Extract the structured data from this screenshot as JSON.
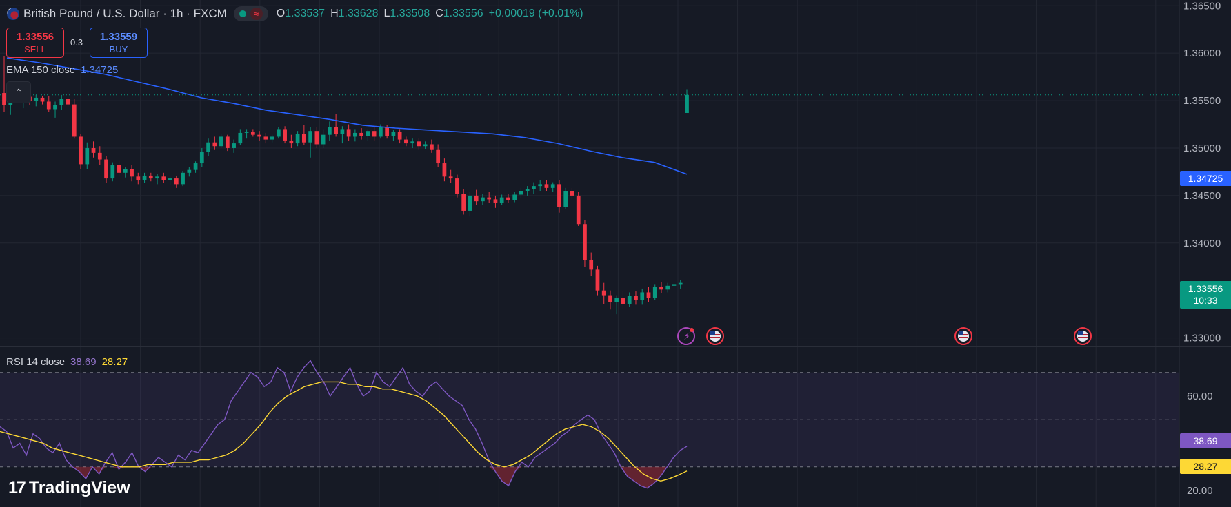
{
  "header": {
    "title": "British Pound / U.S. Dollar · 1h · FXCM",
    "ohlc": [
      {
        "k": "O",
        "v": "1.33537"
      },
      {
        "k": "H",
        "v": "1.33628"
      },
      {
        "k": "L",
        "v": "1.33508"
      },
      {
        "k": "C",
        "v": "1.33556"
      }
    ],
    "change": "+0.00019 (+0.01%)",
    "wave_glyph": "≈"
  },
  "trade": {
    "sell_price": "1.33556",
    "sell_label": "SELL",
    "buy_price": "1.33559",
    "buy_label": "BUY",
    "spread": "0.3"
  },
  "ema": {
    "label": "EMA 150 close",
    "value": "1.34725"
  },
  "rsi": {
    "label": "RSI 14 close",
    "value": "38.69",
    "ma_value": "28.27"
  },
  "price_tags": {
    "ema": "1.34725",
    "last": "1.33556",
    "countdown": "10:33",
    "rsi": "38.69",
    "rsi_ma": "28.27"
  },
  "colors": {
    "up": "#089981",
    "down": "#f23645",
    "ema": "#2962ff",
    "rsi": "#7e57c2",
    "rsi_ma": "#fdd835",
    "bg": "#161a25",
    "grid": "#232733"
  },
  "brand": "TradingView",
  "chart_data": [
    {
      "type": "candlestick",
      "title": "British Pound / U.S. Dollar · 1h · FXCM",
      "y_ticks": [
        "1.36500",
        "1.36000",
        "1.35500",
        "1.35000",
        "1.34500",
        "1.34000",
        "1.33000"
      ],
      "ylim": [
        1.3291,
        1.3656
      ],
      "candles": [
        [
          1.3558,
          1.3597,
          1.3538,
          1.3545
        ],
        [
          1.3545,
          1.356,
          1.3535,
          1.3552
        ],
        [
          1.3552,
          1.3558,
          1.354,
          1.3548
        ],
        [
          1.3548,
          1.3556,
          1.3542,
          1.3554
        ],
        [
          1.3554,
          1.3557,
          1.3545,
          1.355
        ],
        [
          1.355,
          1.3556,
          1.3544,
          1.3553
        ],
        [
          1.3553,
          1.3555,
          1.3546,
          1.3549
        ],
        [
          1.3549,
          1.3555,
          1.3538,
          1.3541
        ],
        [
          1.3541,
          1.3549,
          1.3532,
          1.3545
        ],
        [
          1.3545,
          1.3556,
          1.354,
          1.3552
        ],
        [
          1.3552,
          1.356,
          1.3543,
          1.3546
        ],
        [
          1.3546,
          1.3552,
          1.351,
          1.3512
        ],
        [
          1.3512,
          1.3515,
          1.3478,
          1.3483
        ],
        [
          1.3483,
          1.3506,
          1.3478,
          1.35
        ],
        [
          1.35,
          1.3507,
          1.349,
          1.3495
        ],
        [
          1.3495,
          1.3502,
          1.3482,
          1.3488
        ],
        [
          1.3488,
          1.3492,
          1.3463,
          1.3468
        ],
        [
          1.3468,
          1.3485,
          1.3465,
          1.3482
        ],
        [
          1.3482,
          1.3487,
          1.347,
          1.3474
        ],
        [
          1.3474,
          1.348,
          1.3469,
          1.3478
        ],
        [
          1.3478,
          1.3482,
          1.3465,
          1.347
        ],
        [
          1.347,
          1.3474,
          1.3462,
          1.3466
        ],
        [
          1.3466,
          1.3474,
          1.3463,
          1.3471
        ],
        [
          1.3471,
          1.3474,
          1.3465,
          1.3468
        ],
        [
          1.3468,
          1.3473,
          1.3462,
          1.347
        ],
        [
          1.347,
          1.3474,
          1.3463,
          1.3466
        ],
        [
          1.3466,
          1.347,
          1.3461,
          1.3468
        ],
        [
          1.3468,
          1.3471,
          1.3458,
          1.3462
        ],
        [
          1.3462,
          1.3476,
          1.346,
          1.3474
        ],
        [
          1.3474,
          1.348,
          1.347,
          1.3477
        ],
        [
          1.3477,
          1.3486,
          1.3474,
          1.3484
        ],
        [
          1.3484,
          1.35,
          1.348,
          1.3496
        ],
        [
          1.3496,
          1.351,
          1.3492,
          1.3506
        ],
        [
          1.3506,
          1.3512,
          1.3498,
          1.3502
        ],
        [
          1.3502,
          1.3515,
          1.35,
          1.3512
        ],
        [
          1.3512,
          1.3514,
          1.3497,
          1.35
        ],
        [
          1.35,
          1.3509,
          1.3495,
          1.3505
        ],
        [
          1.3505,
          1.352,
          1.3503,
          1.3516
        ],
        [
          1.3516,
          1.352,
          1.351,
          1.3517
        ],
        [
          1.3517,
          1.352,
          1.3512,
          1.3514
        ],
        [
          1.3514,
          1.3518,
          1.3508,
          1.3512
        ],
        [
          1.3512,
          1.3516,
          1.3505,
          1.3509
        ],
        [
          1.3509,
          1.3514,
          1.3506,
          1.3512
        ],
        [
          1.3512,
          1.3522,
          1.351,
          1.352
        ],
        [
          1.352,
          1.3523,
          1.3505,
          1.3508
        ],
        [
          1.3508,
          1.3514,
          1.35,
          1.3505
        ],
        [
          1.3505,
          1.3518,
          1.3502,
          1.3515
        ],
        [
          1.3515,
          1.3524,
          1.3503,
          1.3506
        ],
        [
          1.3506,
          1.3522,
          1.349,
          1.3518
        ],
        [
          1.3518,
          1.3522,
          1.35,
          1.3504
        ],
        [
          1.3504,
          1.352,
          1.35,
          1.3514
        ],
        [
          1.3514,
          1.3528,
          1.3508,
          1.3522
        ],
        [
          1.3522,
          1.3536,
          1.3512,
          1.3515
        ],
        [
          1.3515,
          1.3523,
          1.3505,
          1.352
        ],
        [
          1.352,
          1.3525,
          1.3508,
          1.3512
        ],
        [
          1.3512,
          1.352,
          1.3507,
          1.3516
        ],
        [
          1.3516,
          1.3521,
          1.3509,
          1.3513
        ],
        [
          1.3513,
          1.352,
          1.3508,
          1.3518
        ],
        [
          1.3518,
          1.3522,
          1.3508,
          1.3512
        ],
        [
          1.3512,
          1.3525,
          1.351,
          1.3522
        ],
        [
          1.3522,
          1.3524,
          1.351,
          1.3513
        ],
        [
          1.3513,
          1.3519,
          1.3508,
          1.3517
        ],
        [
          1.3517,
          1.352,
          1.3505,
          1.3509
        ],
        [
          1.3509,
          1.3512,
          1.3502,
          1.3505
        ],
        [
          1.3505,
          1.351,
          1.35,
          1.3507
        ],
        [
          1.3507,
          1.351,
          1.3498,
          1.3502
        ],
        [
          1.3502,
          1.3507,
          1.3499,
          1.3504
        ],
        [
          1.3504,
          1.3509,
          1.3495,
          1.3498
        ],
        [
          1.3498,
          1.3504,
          1.348,
          1.3484
        ],
        [
          1.3484,
          1.3489,
          1.3465,
          1.347
        ],
        [
          1.347,
          1.3477,
          1.3463,
          1.3468
        ],
        [
          1.3468,
          1.3472,
          1.3448,
          1.3452
        ],
        [
          1.3452,
          1.3457,
          1.343,
          1.3434
        ],
        [
          1.3434,
          1.3454,
          1.3428,
          1.345
        ],
        [
          1.345,
          1.3456,
          1.344,
          1.3444
        ],
        [
          1.3444,
          1.3452,
          1.344,
          1.3448
        ],
        [
          1.3448,
          1.3454,
          1.3442,
          1.3446
        ],
        [
          1.3446,
          1.345,
          1.3437,
          1.3442
        ],
        [
          1.3442,
          1.3451,
          1.344,
          1.3448
        ],
        [
          1.3448,
          1.3452,
          1.3442,
          1.3445
        ],
        [
          1.3445,
          1.3454,
          1.3443,
          1.3451
        ],
        [
          1.3451,
          1.3458,
          1.3447,
          1.3455
        ],
        [
          1.3455,
          1.346,
          1.345,
          1.3457
        ],
        [
          1.3457,
          1.3464,
          1.3452,
          1.346
        ],
        [
          1.346,
          1.3466,
          1.3455,
          1.3462
        ],
        [
          1.3462,
          1.3466,
          1.3455,
          1.3458
        ],
        [
          1.3458,
          1.3464,
          1.3454,
          1.3462
        ],
        [
          1.3462,
          1.3466,
          1.3432,
          1.3438
        ],
        [
          1.3438,
          1.3458,
          1.3436,
          1.3455
        ],
        [
          1.3455,
          1.3458,
          1.3446,
          1.345
        ],
        [
          1.345,
          1.3454,
          1.3418,
          1.342
        ],
        [
          1.342,
          1.3424,
          1.3375,
          1.3382
        ],
        [
          1.3382,
          1.339,
          1.3365,
          1.3372
        ],
        [
          1.3372,
          1.3376,
          1.3345,
          1.335
        ],
        [
          1.335,
          1.3358,
          1.3336,
          1.3345
        ],
        [
          1.3345,
          1.335,
          1.333,
          1.3338
        ],
        [
          1.3338,
          1.3345,
          1.3325,
          1.3342
        ],
        [
          1.3342,
          1.335,
          1.333,
          1.3336
        ],
        [
          1.3336,
          1.3348,
          1.3333,
          1.3344
        ],
        [
          1.3344,
          1.3349,
          1.3335,
          1.334
        ],
        [
          1.334,
          1.3352,
          1.3335,
          1.3348
        ],
        [
          1.3348,
          1.3354,
          1.3338,
          1.3342
        ],
        [
          1.3342,
          1.3356,
          1.334,
          1.3354
        ],
        [
          1.3354,
          1.3359,
          1.3347,
          1.3351
        ],
        [
          1.3351,
          1.3358,
          1.3348,
          1.3355
        ],
        [
          1.3355,
          1.3359,
          1.3352,
          1.3356
        ],
        [
          1.3356,
          1.3361,
          1.3352,
          1.3358
        ],
        [
          1.3537,
          1.3562,
          1.355,
          1.3556
        ]
      ],
      "ema150": [
        1.3595,
        1.359,
        1.3584,
        1.3578,
        1.357,
        1.3562,
        1.3553,
        1.3547,
        1.354,
        1.3535,
        1.353,
        1.3524,
        1.3521,
        1.3519,
        1.3517,
        1.3515,
        1.3511,
        1.3505,
        1.3497,
        1.349,
        1.3485,
        1.34725
      ],
      "series": [
        {
          "name": "EMA 150 close"
        }
      ]
    },
    {
      "type": "line",
      "y_ticks": [
        "60.00",
        "20.00"
      ],
      "ylim": [
        13,
        81
      ],
      "bands": [
        70,
        50,
        30
      ],
      "rsi": [
        47,
        45,
        38,
        40,
        35,
        44,
        42,
        38,
        36,
        40,
        33,
        30,
        28,
        25,
        30,
        27,
        32,
        36,
        29,
        32,
        36,
        30,
        28,
        31,
        34,
        32,
        30,
        35,
        33,
        37,
        36,
        40,
        44,
        48,
        50,
        58,
        62,
        66,
        70,
        68,
        64,
        66,
        72,
        70,
        62,
        68,
        72,
        75,
        70,
        66,
        60,
        64,
        68,
        72,
        65,
        60,
        62,
        70,
        66,
        64,
        68,
        72,
        65,
        62,
        60,
        64,
        66,
        63,
        60,
        58,
        56,
        50,
        46,
        40,
        33,
        28,
        24,
        22,
        28,
        32,
        30,
        34,
        36,
        38,
        40,
        43,
        45,
        48,
        50,
        52,
        50,
        44,
        40,
        36,
        30,
        26,
        24,
        22,
        21,
        23,
        26,
        30,
        34,
        37,
        38.69
      ],
      "rsi_ma": [
        45,
        44,
        43,
        42,
        41,
        40,
        38,
        37,
        36,
        35,
        34,
        33,
        32,
        31,
        30,
        30,
        30,
        31,
        31,
        31,
        32,
        32,
        32,
        33,
        33,
        34,
        35,
        37,
        40,
        44,
        48,
        53,
        57,
        60,
        62,
        64,
        65,
        66,
        66,
        66,
        65,
        65,
        64,
        64,
        63,
        63,
        62,
        61,
        60,
        58,
        55,
        52,
        48,
        44,
        40,
        36,
        33,
        31,
        30,
        31,
        33,
        35,
        38,
        41,
        44,
        46,
        47,
        48,
        47,
        45,
        42,
        38,
        34,
        30,
        27,
        25,
        24,
        25,
        26.5,
        28.27
      ],
      "series": [
        {
          "name": "RSI 14 close"
        }
      ]
    }
  ]
}
